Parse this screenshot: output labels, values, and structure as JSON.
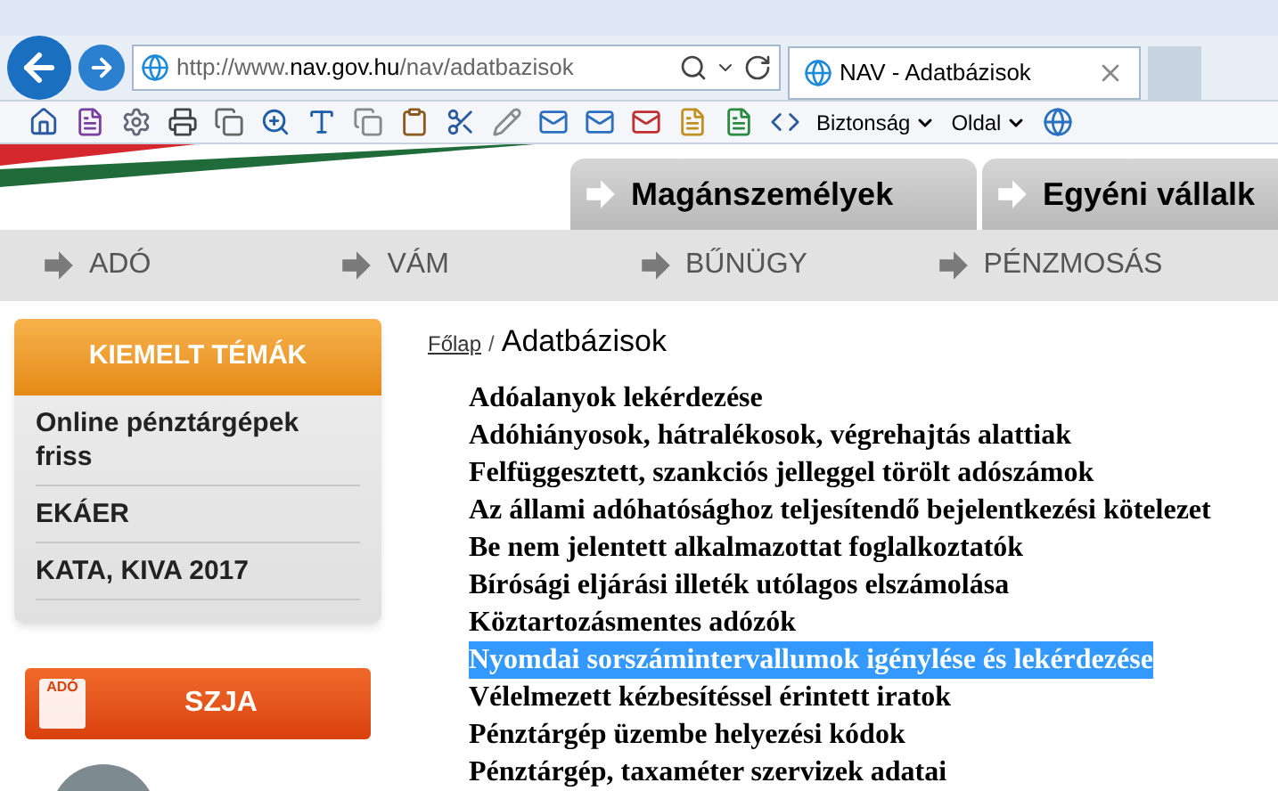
{
  "browser": {
    "url_host": "http://www.",
    "url_domain": "nav.gov.hu",
    "url_path": "/nav/adatbazisok",
    "tab_title": "NAV - Adatbázisok",
    "toolbar_menus": [
      "Biztonság",
      "Oldal"
    ]
  },
  "header_tabs": [
    {
      "label": "Magánszemélyek"
    },
    {
      "label": "Egyéni vállalk"
    }
  ],
  "nav": [
    {
      "label": "ADÓ"
    },
    {
      "label": "VÁM"
    },
    {
      "label": "BŰNÜGY"
    },
    {
      "label": "PÉNZMOSÁS"
    }
  ],
  "sidebar": {
    "title": "KIEMELT TÉMÁK",
    "items": [
      "Online pénztárgépek friss",
      "EKÁER",
      "KATA, KIVA 2017"
    ],
    "szja_badge": "ADÓ",
    "szja_label": "SZJA"
  },
  "breadcrumb": {
    "link": "Főlap",
    "separator": "/",
    "current": "Adatbázisok"
  },
  "databases": [
    {
      "label": "Adóalanyok lekérdezése",
      "selected": false
    },
    {
      "label": "Adóhiányosok, hátralékosok, végrehajtás alattiak",
      "selected": false
    },
    {
      "label": "Felfüggesztett, szankciós jelleggel törölt adószámok",
      "selected": false
    },
    {
      "label": "Az állami adóhatósághoz teljesítendő bejelentkezési kötelezet",
      "selected": false
    },
    {
      "label": "Be nem jelentett alkalmazottat foglalkoztatók",
      "selected": false
    },
    {
      "label": "Bírósági eljárási illeték utólagos elszámolása",
      "selected": false
    },
    {
      "label": "Köztartozásmentes adózók",
      "selected": false
    },
    {
      "label": "Nyomdai sorszámintervallumok igénylése és lekérdezése",
      "selected": true
    },
    {
      "label": "Vélelmezett kézbesítéssel érintett iratok",
      "selected": false
    },
    {
      "label": "Pénztárgép üzembe helyezési kódok",
      "selected": false
    },
    {
      "label": "Pénztárgép, taxaméter szervizek adatai",
      "selected": false
    }
  ]
}
